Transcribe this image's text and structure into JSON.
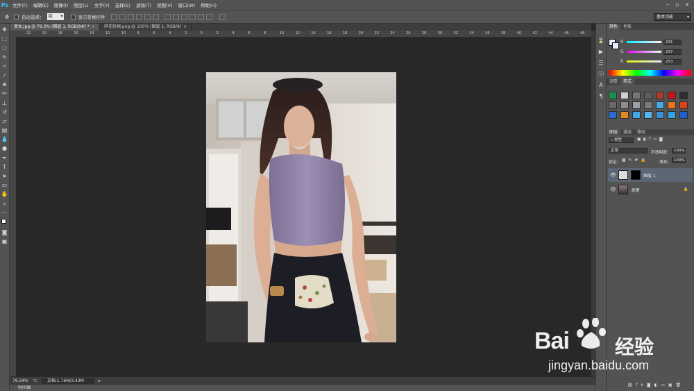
{
  "menu": {
    "logo": "Ps",
    "items": [
      "文件(F)",
      "编辑(E)",
      "图像(I)",
      "图层(L)",
      "文字(Y)",
      "选择(S)",
      "滤镜(T)",
      "视图(V)",
      "窗口(W)",
      "帮助(H)"
    ]
  },
  "options": {
    "auto_select_label": "自动选择：",
    "auto_select_value": "组",
    "show_transform_label": "显示变换控件",
    "workspace": "基本功能"
  },
  "tabs": [
    {
      "label": "美女.jpg @ 79.3% (图层 1, RGB/8#) *",
      "close": "×"
    },
    {
      "label": "碎花短裙.png @ 100% (图层 1, RGB/8)",
      "close": "×"
    }
  ],
  "ruler": {
    "h_ticks": [
      "22",
      "20",
      "18",
      "16",
      "14",
      "12",
      "10",
      "8",
      "6",
      "4",
      "2",
      "0",
      "2",
      "4",
      "6",
      "8",
      "10",
      "12",
      "14",
      "16",
      "18",
      "20",
      "22",
      "24",
      "26",
      "28",
      "30",
      "32",
      "34",
      "36",
      "38",
      "40",
      "42",
      "44",
      "46",
      "48"
    ]
  },
  "status": {
    "zoom": "79.34%",
    "doc_size": "文档:1.76M/3.43M",
    "timeline": "时间轴"
  },
  "color_panel": {
    "tabs": [
      "颜色",
      "色板"
    ],
    "r_label": "R",
    "r_value": "231",
    "g_label": "G",
    "g_value": "237",
    "b_label": "B",
    "b_value": "253",
    "fg_color": "#e7edfd"
  },
  "styles_panel": {
    "tabs": [
      "调整",
      "样式"
    ]
  },
  "layers_panel": {
    "tabs": [
      "图层",
      "通道",
      "路径"
    ],
    "filter_type": "类型",
    "blend_mode": "正常",
    "opacity_label": "不透明度:",
    "opacity_value": "100%",
    "lock_label": "锁定:",
    "fill_label": "填充:",
    "fill_value": "100%",
    "layers": [
      {
        "name": "图层 1",
        "selected": true
      },
      {
        "name": "背景",
        "selected": false
      }
    ]
  },
  "watermark": {
    "brand": "Bai",
    "brand_suffix": "经验",
    "url": "jingyan.baidu.com"
  }
}
